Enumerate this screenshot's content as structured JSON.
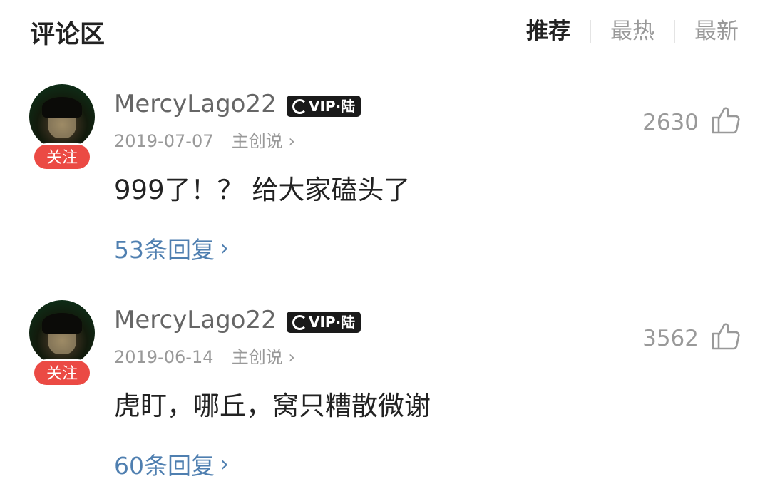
{
  "header": {
    "title": "评论区",
    "sort_tabs": [
      {
        "label": "推荐",
        "active": true
      },
      {
        "label": "最热",
        "active": false
      },
      {
        "label": "最新",
        "active": false
      }
    ]
  },
  "comments": [
    {
      "username": "MercyLago22",
      "vip_badge": "VIP·陆",
      "date": "2019-07-07",
      "role": "主创说",
      "follow_label": "关注",
      "likes": "2630",
      "text": "999了！？ 给大家磕头了",
      "replies": "53条回复"
    },
    {
      "username": "MercyLago22",
      "vip_badge": "VIP·陆",
      "date": "2019-06-14",
      "role": "主创说",
      "follow_label": "关注",
      "likes": "3562",
      "text": "虎盯，哪丘，窝只糟散微谢",
      "replies": "60条回复"
    }
  ],
  "colors": {
    "accent_red": "#eb4a44",
    "link_blue": "#4f7fb0"
  }
}
